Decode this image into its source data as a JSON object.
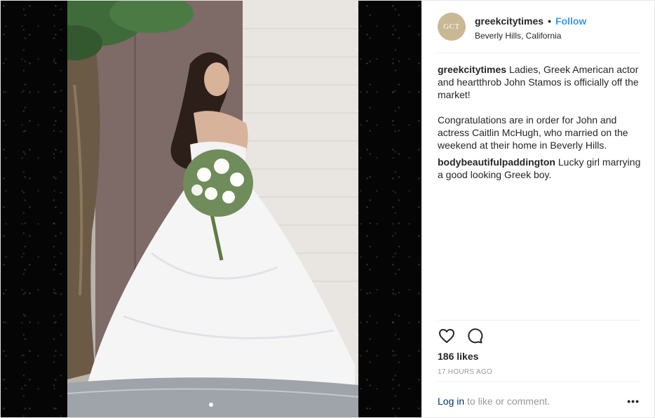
{
  "post": {
    "username": "greekcitytimes",
    "separator": "•",
    "follow_label": "Follow",
    "location": "Beverly Hills, California",
    "avatar_text": "GCT"
  },
  "caption": {
    "username": "greekcitytimes",
    "text_1": "Ladies, Greek American actor and heartthrob John Stamos is officially off the market!",
    "text_2": "Congratulations are in order for John and actress Caitlin McHugh, who married on the weekend at their home in Beverly Hills."
  },
  "comments": [
    {
      "username": "bodybeautifulpaddington",
      "text": "Lucky girl marrying a good looking Greek boy."
    }
  ],
  "stats": {
    "likes": "186 likes",
    "time": "17 HOURS AGO"
  },
  "footer": {
    "login_label": "Log in",
    "rest": "to like or comment.",
    "more_label": "•••"
  },
  "icons": {
    "like": "heart-outline-icon",
    "comment": "comment-bubble-icon",
    "more": "more-options-icon"
  },
  "colors": {
    "link_blue": "#3897f0",
    "login_blue": "#003569",
    "muted_gray": "#999999",
    "avatar_gold": "#c8b893"
  }
}
